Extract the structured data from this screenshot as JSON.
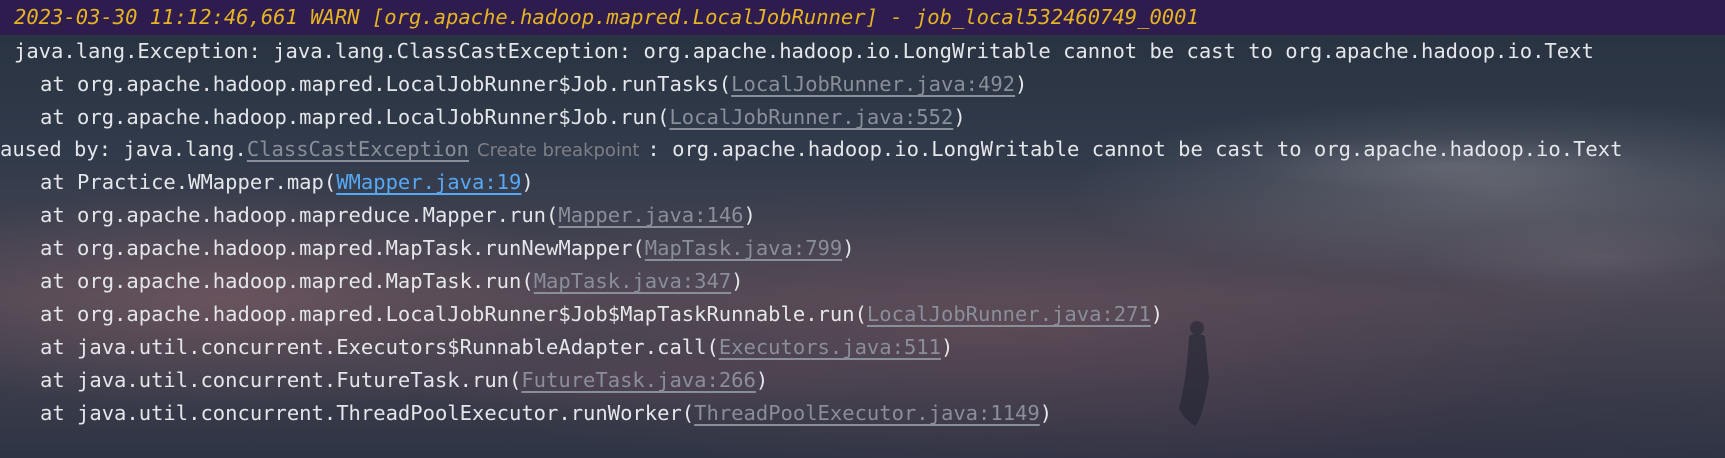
{
  "header": {
    "text": "2023-03-30 11:12:46,661 WARN [org.apache.hadoop.mapred.LocalJobRunner] - job_local532460749_0001"
  },
  "exception_line": "java.lang.Exception: java.lang.ClassCastException: org.apache.hadoop.io.LongWritable cannot be cast to org.apache.hadoop.io.Text",
  "frames_top": [
    {
      "prefix": "at org.apache.hadoop.mapred.LocalJobRunner$Job.runTasks(",
      "link": "LocalJobRunner.java:492",
      "suffix": ")"
    },
    {
      "prefix": "at org.apache.hadoop.mapred.LocalJobRunner$Job.run(",
      "link": "LocalJobRunner.java:552",
      "suffix": ")"
    }
  ],
  "caused_by": {
    "prefix": "aused by: java.lang.",
    "link": "ClassCastException",
    "hint": "Create breakpoint",
    "suffix": ": org.apache.hadoop.io.LongWritable cannot be cast to org.apache.hadoop.io.Text"
  },
  "frames_bottom": [
    {
      "prefix": "at Practice.WMapper.map(",
      "link": "WMapper.java:19",
      "suffix": ")"
    },
    {
      "prefix": "at org.apache.hadoop.mapreduce.Mapper.run(",
      "link": "Mapper.java:146",
      "suffix": ")"
    },
    {
      "prefix": "at org.apache.hadoop.mapred.MapTask.runNewMapper(",
      "link": "MapTask.java:799",
      "suffix": ")"
    },
    {
      "prefix": "at org.apache.hadoop.mapred.MapTask.run(",
      "link": "MapTask.java:347",
      "suffix": ")"
    },
    {
      "prefix": "at org.apache.hadoop.mapred.LocalJobRunner$Job$MapTaskRunnable.run(",
      "link": "LocalJobRunner.java:271",
      "suffix": ")"
    },
    {
      "prefix": "at java.util.concurrent.Executors$RunnableAdapter.call(",
      "link": "Executors.java:511",
      "suffix": ")"
    },
    {
      "prefix": "at java.util.concurrent.FutureTask.run(",
      "link": "FutureTask.java:266",
      "suffix": ")"
    },
    {
      "prefix": "at java.util.concurrent.ThreadPoolExecutor.runWorker(",
      "link": "ThreadPoolExecutor.java:1149",
      "suffix": ")"
    }
  ],
  "colors": {
    "header_bg": "#2e1c4f",
    "header_text": "#e6b422",
    "text": "#e4e6ea",
    "link": "#8a8e99",
    "active_link": "#56a8f5"
  }
}
